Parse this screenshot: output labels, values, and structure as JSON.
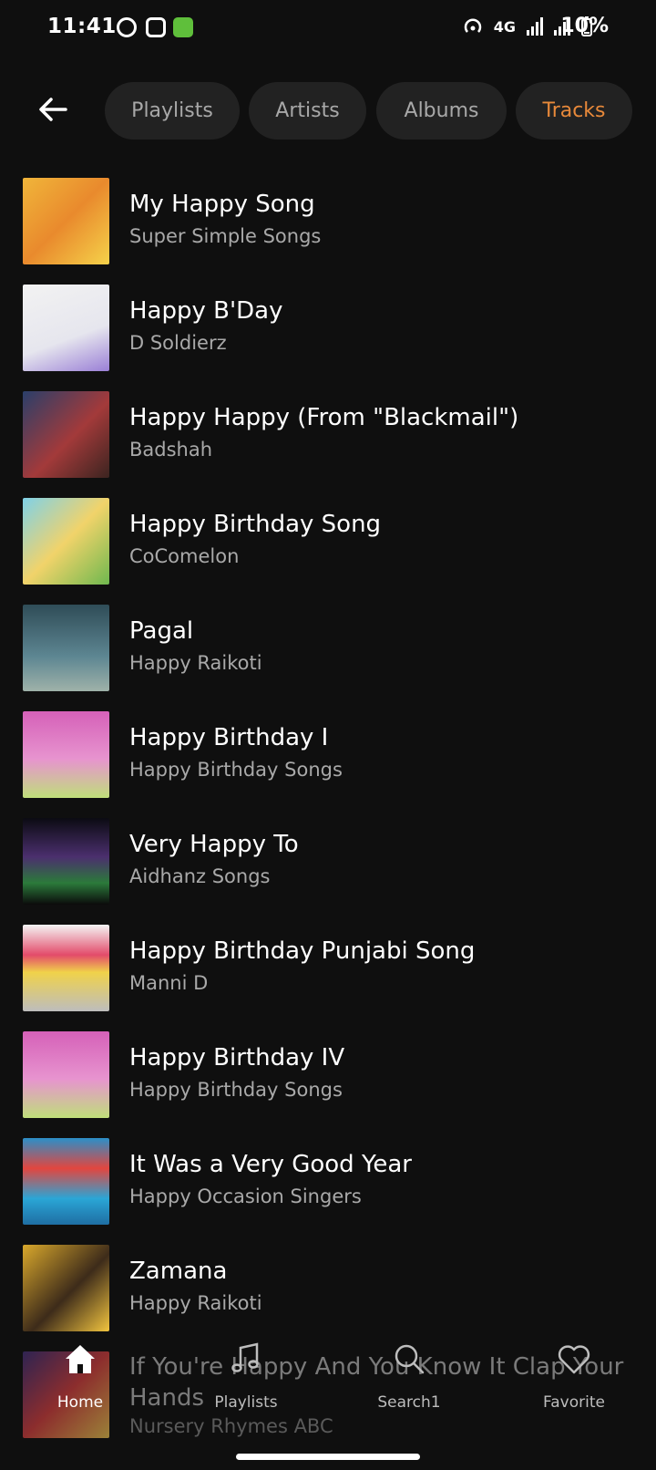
{
  "status_bar": {
    "time": "11:41",
    "network": "4G",
    "battery": "10%"
  },
  "tabs": [
    {
      "label": "Playlists",
      "active": false
    },
    {
      "label": "Artists",
      "active": false
    },
    {
      "label": "Albums",
      "active": false
    },
    {
      "label": "Tracks",
      "active": true
    }
  ],
  "colors": {
    "accent": "#e8893a",
    "background": "#0f0f0f",
    "chip": "#222222"
  },
  "tracks": [
    {
      "title": "My Happy Song",
      "artist": "Super Simple Songs"
    },
    {
      "title": "Happy B'Day",
      "artist": "D Soldierz"
    },
    {
      "title": "Happy Happy (From \"Blackmail\")",
      "artist": "Badshah"
    },
    {
      "title": "Happy Birthday Song",
      "artist": "CoComelon"
    },
    {
      "title": "Pagal",
      "artist": "Happy Raikoti"
    },
    {
      "title": "Happy Birthday I",
      "artist": "Happy Birthday Songs"
    },
    {
      "title": "Very Happy To",
      "artist": "Aidhanz Songs"
    },
    {
      "title": "Happy Birthday Punjabi Song",
      "artist": "Manni D"
    },
    {
      "title": "Happy Birthday IV",
      "artist": "Happy Birthday Songs"
    },
    {
      "title": "It Was a Very Good Year",
      "artist": "Happy Occasion Singers"
    },
    {
      "title": "Zamana",
      "artist": "Happy Raikoti"
    },
    {
      "title": "If You're Happy And You Know It Clap Your Hands",
      "artist": "Nursery Rhymes ABC"
    }
  ],
  "bottom_nav": [
    {
      "label": "Home",
      "icon": "home-icon",
      "active": true
    },
    {
      "label": "Playlists",
      "icon": "music-note-icon",
      "active": false
    },
    {
      "label": "Search1",
      "icon": "search-icon",
      "active": false
    },
    {
      "label": "Favorite",
      "icon": "heart-icon",
      "active": false
    }
  ]
}
